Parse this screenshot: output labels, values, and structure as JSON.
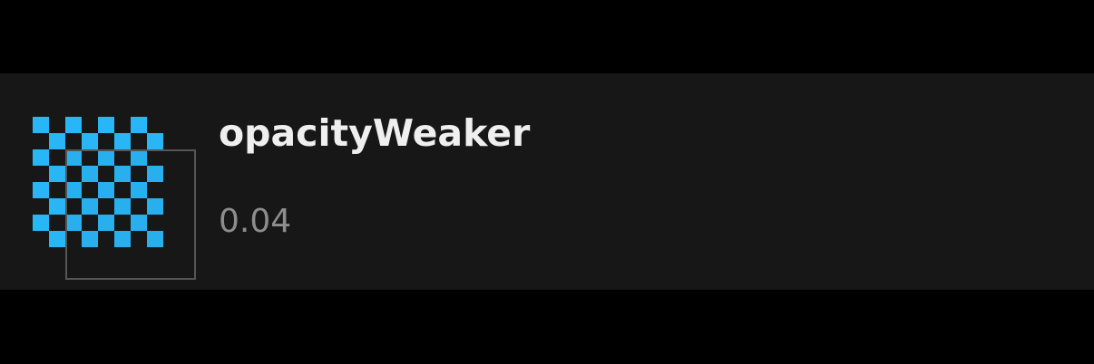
{
  "token": {
    "name": "opacityWeaker",
    "value": "0.04",
    "icon": "opacity-swatch-icon",
    "colors": {
      "checker": "#29b6f6",
      "overlay_border": "#555555",
      "overlay_fill": "#262626"
    }
  }
}
